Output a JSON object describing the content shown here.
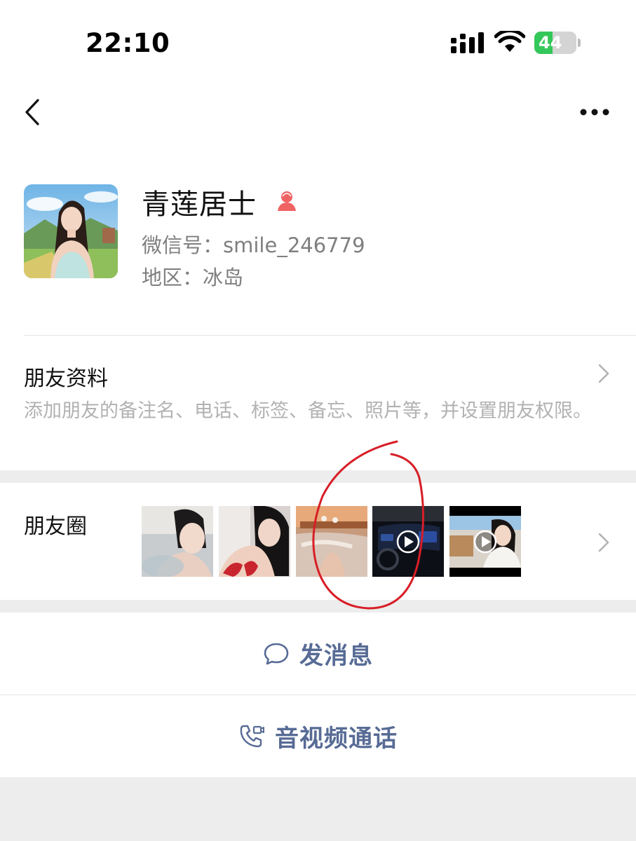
{
  "status_bar": {
    "time": "22:10",
    "battery_level": "44",
    "battery_fraction": 0.44,
    "battery_color": "#34c759"
  },
  "nav": {
    "back_icon": "chevron-left-icon",
    "more_icon": "more-horizontal-icon"
  },
  "profile": {
    "nickname": "青莲居士",
    "gender_icon": "female-icon",
    "gender_color": "#fa5151",
    "wechat_id": "微信号：smile_246779",
    "region": "地区：冰岛"
  },
  "friend_info": {
    "title": "朋友资料",
    "description": "添加朋友的备注名、电话、标签、备忘、照片等，并设置朋友权限。"
  },
  "moments": {
    "title": "朋友圈",
    "thumbnails": [
      {
        "kind": "photo"
      },
      {
        "kind": "photo"
      },
      {
        "kind": "photo"
      },
      {
        "kind": "video"
      },
      {
        "kind": "video"
      }
    ],
    "annotation_color": "#d81e27"
  },
  "actions": {
    "message_label": "发消息",
    "message_icon": "chat-bubble-icon",
    "call_label": "音视频通话",
    "call_icon": "phone-video-icon",
    "link_color": "#576b95"
  }
}
